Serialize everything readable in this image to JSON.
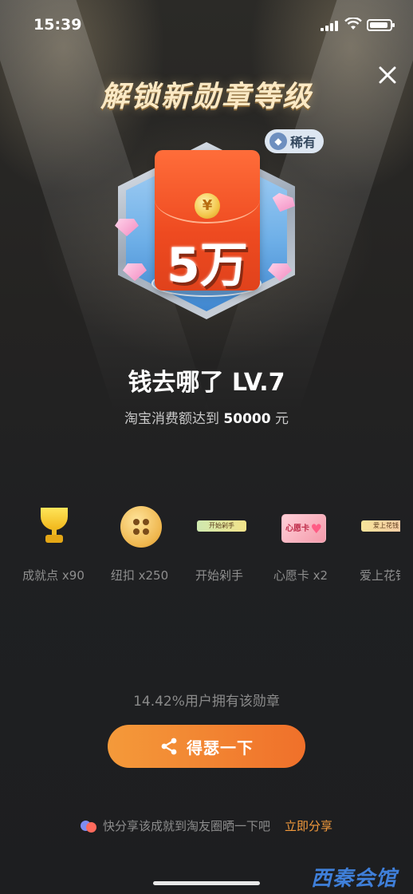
{
  "status_bar": {
    "time": "15:39"
  },
  "header": {
    "title": "解锁新勋章等级",
    "close_icon": "close-icon"
  },
  "badge": {
    "rarity": "稀有",
    "amount_text": "5万",
    "coin_symbol": "¥",
    "name": "钱去哪了 LV.7",
    "desc_prefix": "淘宝消费额达到 ",
    "desc_value": "50000",
    "desc_suffix": " 元"
  },
  "rewards": [
    {
      "label": "成就点 x90",
      "icon": "trophy-icon"
    },
    {
      "label": "纽扣 x250",
      "icon": "button-icon"
    },
    {
      "label": "开始剁手",
      "icon": "tag-icon",
      "tag_text": "开始剁手"
    },
    {
      "label": "心愿卡 x2",
      "icon": "wish-card-icon",
      "card_text": "心愿卡"
    },
    {
      "label": "爱上花钱",
      "icon": "tag-icon",
      "tag_text": "爱上花钱"
    }
  ],
  "owned_percent": "14.42%用户拥有该勋章",
  "share_button": {
    "label": "得瑟一下",
    "icon": "share-icon"
  },
  "share_tip": {
    "text": "快分享该成就到淘友圈晒一下吧",
    "link": "立即分享"
  },
  "watermark": "西秦会馆",
  "colors": {
    "accent": "#f0702a",
    "link": "#f39a3c",
    "background": "#1d1e20"
  }
}
